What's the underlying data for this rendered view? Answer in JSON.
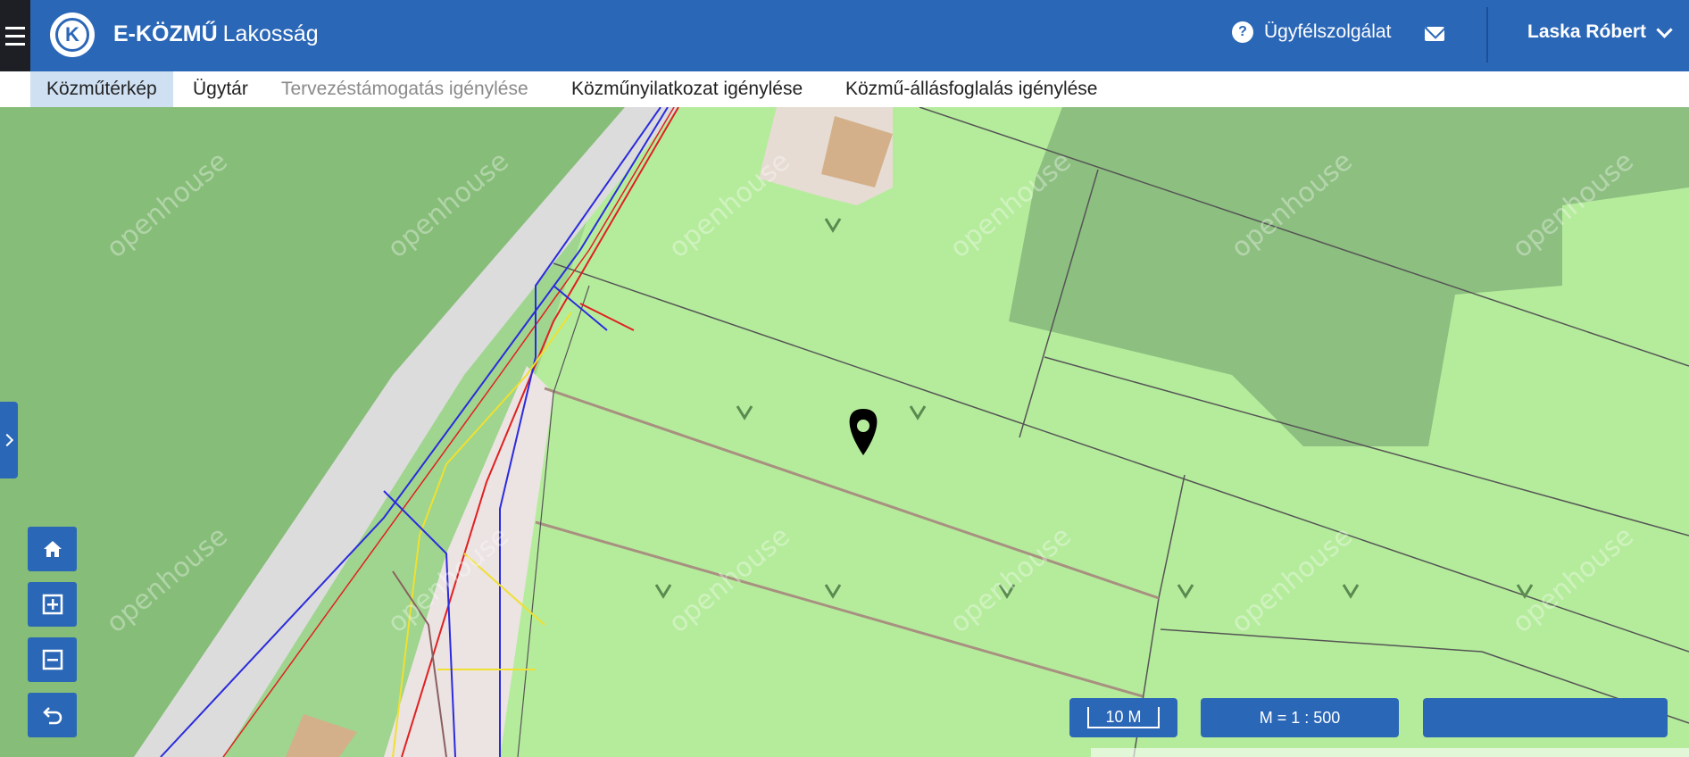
{
  "header": {
    "brand_bold": "E-KÖZMŰ",
    "brand_light": "Lakosság",
    "logo_letter": "K",
    "help_label": "Ügyfélszolgálat",
    "help_icon_glyph": "?",
    "user_name": "Laska Róbert"
  },
  "nav": {
    "items": [
      {
        "label": "Közműtérkép",
        "state": "active"
      },
      {
        "label": "Ügytár",
        "state": "normal"
      },
      {
        "label": "Tervezéstámogatás igénylése",
        "state": "disabled"
      },
      {
        "label": "Közműnyilatkozat igénylése",
        "state": "normal"
      },
      {
        "label": "Közmű-állásfoglalás igénylése",
        "state": "normal"
      }
    ]
  },
  "map": {
    "watermark": "openhouse",
    "scale_length": "10 M",
    "scale_ratio": "M = 1 : 500",
    "colors": {
      "parcel_green": "#b5ec9c",
      "forest_green": "#8dbf80",
      "road_gray": "#d7d7d7",
      "utility_red": "#e02020",
      "utility_blue": "#2b2bdd",
      "utility_yellow": "#f0e030",
      "accent_blue": "#2b67b7"
    }
  },
  "controls": {
    "home": "home-icon",
    "zoom_in": "zoom-in-icon",
    "zoom_out": "zoom-out-icon",
    "back": "undo-icon"
  }
}
